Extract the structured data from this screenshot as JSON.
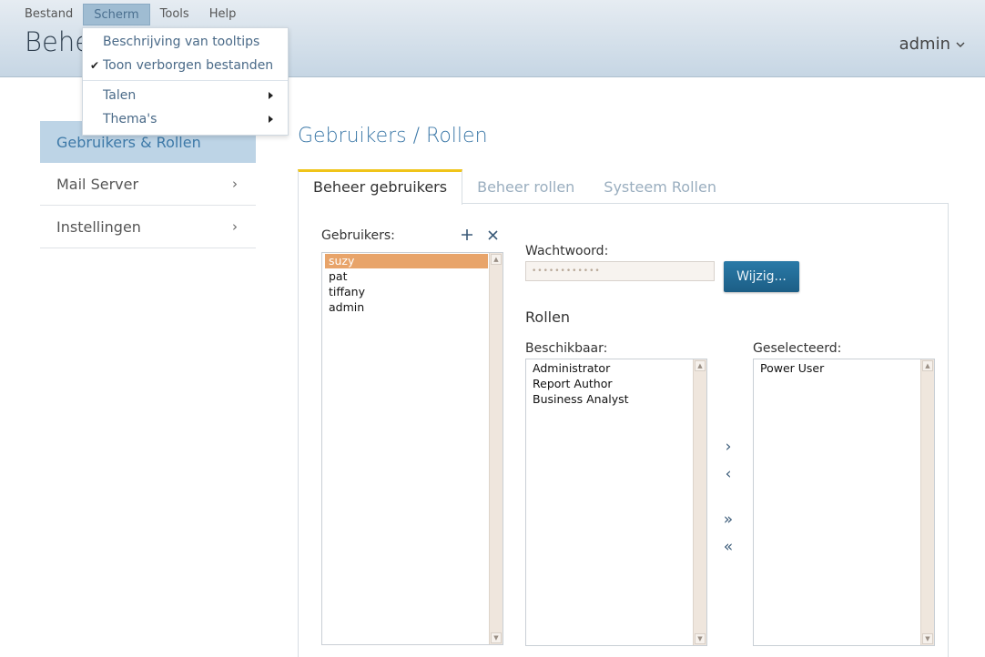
{
  "menubar": {
    "items": [
      "Bestand",
      "Scherm",
      "Tools",
      "Help"
    ],
    "active_index": 1
  },
  "header": {
    "app_title": "Behe",
    "user": "admin"
  },
  "dropdown": {
    "items": [
      {
        "label": "Beschrijving van tooltips",
        "checked": false
      },
      {
        "label": "Toon verborgen bestanden",
        "checked": true
      }
    ],
    "submenus": [
      {
        "label": "Talen"
      },
      {
        "label": "Thema's"
      }
    ]
  },
  "sidebar": {
    "items": [
      {
        "label": "Gebruikers & Rollen",
        "active": true
      },
      {
        "label": "Mail Server",
        "active": false
      },
      {
        "label": "Instellingen",
        "active": false
      }
    ]
  },
  "main": {
    "title": "Gebruikers / Rollen",
    "tabs": [
      {
        "label": "Beheer gebruikers",
        "active": true
      },
      {
        "label": "Beheer rollen",
        "active": false
      },
      {
        "label": "Systeem Rollen",
        "active": false
      }
    ]
  },
  "users": {
    "label": "Gebruikers:",
    "list": [
      "suzy",
      "pat",
      "tiffany",
      "admin"
    ],
    "selected_index": 0
  },
  "password": {
    "label": "Wachtwoord:",
    "value": "••••••••••••",
    "button": "Wijzig..."
  },
  "roles": {
    "title": "Rollen",
    "available_label": "Beschikbaar:",
    "available": [
      "Administrator",
      "Report Author",
      "Business Analyst"
    ],
    "selected_label": "Geselecteerd:",
    "selected": [
      "Power User"
    ]
  },
  "colors": {
    "accent": "#3d79a8",
    "tab_highlight": "#f0c419",
    "selection": "#e8a46a",
    "button": "#1c5e86"
  }
}
